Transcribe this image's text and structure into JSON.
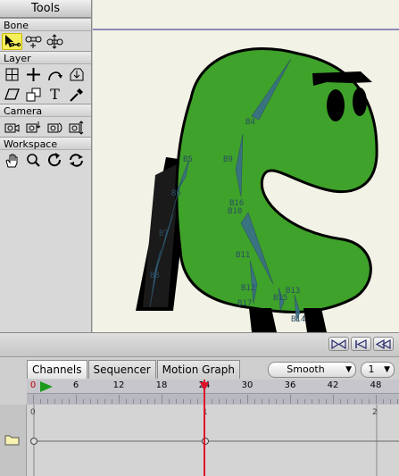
{
  "tools": {
    "title": "Tools",
    "groups": [
      {
        "label": "Bone",
        "items": [
          {
            "icon": "select-bone-icon",
            "active": true
          },
          {
            "icon": "translate-bone-icon"
          },
          {
            "icon": "scale-bone-icon"
          }
        ]
      },
      {
        "label": "Layer",
        "items": [
          {
            "icon": "set-origin-icon"
          },
          {
            "icon": "translate-layer-icon"
          },
          {
            "icon": "rotate-layer-icon"
          },
          {
            "icon": "scale-layer-icon"
          },
          {
            "icon": "shear-layer-icon"
          },
          {
            "icon": "perspective-layer-icon"
          },
          {
            "icon": "text-icon",
            "glyph": "T"
          },
          {
            "icon": "eyedropper-icon"
          }
        ]
      },
      {
        "label": "Camera",
        "items": [
          {
            "icon": "camera-track-icon"
          },
          {
            "icon": "camera-zoom-icon"
          },
          {
            "icon": "camera-roll-icon"
          },
          {
            "icon": "camera-pan-tilt-icon"
          }
        ]
      },
      {
        "label": "Workspace",
        "items": [
          {
            "icon": "hand-pan-icon"
          },
          {
            "icon": "zoom-magnifier-icon"
          },
          {
            "icon": "rotate-workspace-icon"
          },
          {
            "icon": "reset-workspace-icon"
          }
        ]
      }
    ]
  },
  "canvas": {
    "bone_labels": [
      "B4",
      "B5",
      "B6",
      "B7",
      "B8",
      "B9",
      "B10",
      "B11",
      "B12",
      "B13",
      "B14",
      "B15",
      "B16",
      "B17"
    ],
    "colors": {
      "body": "#3fa22a",
      "outline": "#000000",
      "bone": "#3a6e8a",
      "background": "#f3f2e6"
    }
  },
  "timeline": {
    "tabs": [
      "Channels",
      "Sequencer",
      "Motion Graph"
    ],
    "active_tab": "Channels",
    "interpolation": "Smooth",
    "frame_step": "1",
    "ruler_labels": [
      "0",
      "6",
      "12",
      "18",
      "24",
      "30",
      "36",
      "42",
      "48"
    ],
    "current_frame": 24,
    "graph_scale": [
      "0",
      "1",
      "2"
    ]
  }
}
